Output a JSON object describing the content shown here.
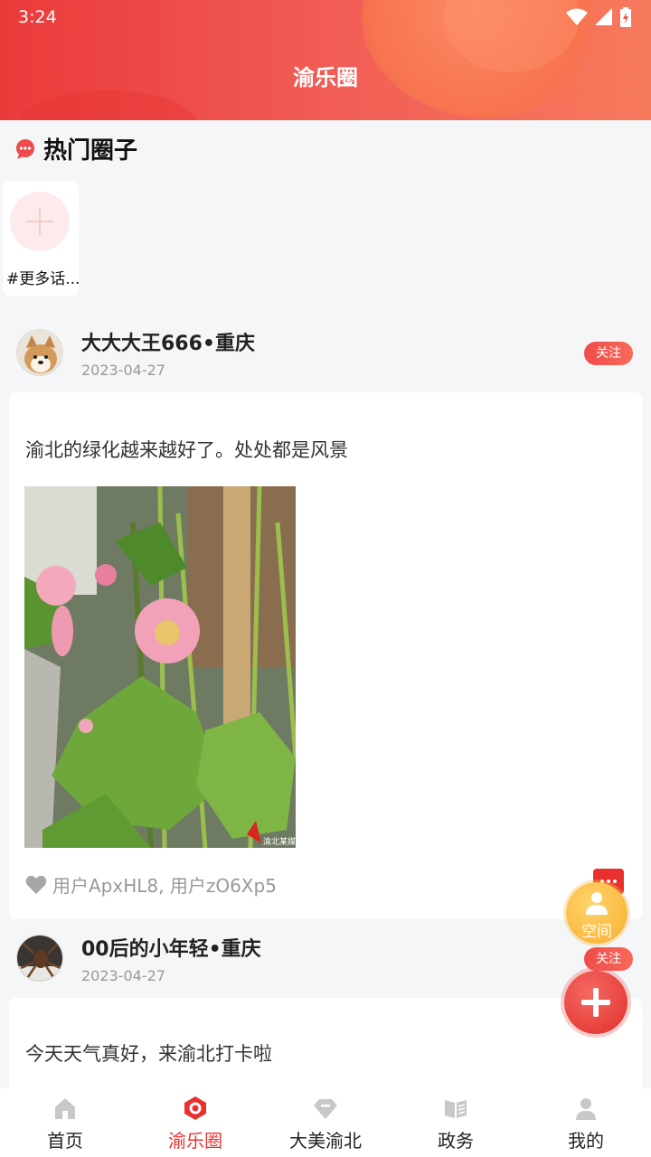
{
  "status_bar": {
    "time": "3:24"
  },
  "header": {
    "title": "渝乐圈"
  },
  "hot_circles": {
    "title": "热门圈子",
    "more_label": "#更多话..."
  },
  "posts": [
    {
      "author": "大大大王666•重庆",
      "date": "2023-04-27",
      "follow_label": "关注",
      "text": "渝北的绿化越来越好了。处处都是风景",
      "photo_watermark": "渝北某媒",
      "likes": "用户ApxHL8, 用户zO6Xp5"
    },
    {
      "author": "00后的小年轻•重庆",
      "date": "2023-04-27",
      "follow_label": "关注",
      "text": "今天天气真好，来渝北打卡啦"
    }
  ],
  "fab": {
    "space_label": "空间"
  },
  "tabbar": {
    "items": [
      {
        "label": "首页",
        "icon": "home-icon",
        "active": false
      },
      {
        "label": "渝乐圈",
        "icon": "circle-hexagon-icon",
        "active": true
      },
      {
        "label": "大美渝北",
        "icon": "diamond-icon",
        "active": false
      },
      {
        "label": "政务",
        "icon": "book-icon",
        "active": false
      },
      {
        "label": "我的",
        "icon": "user-icon",
        "active": false
      }
    ]
  },
  "colors": {
    "accent": "#e8312f",
    "fab_yellow": "#f9b63b",
    "follow_red": "#f04b4b"
  }
}
